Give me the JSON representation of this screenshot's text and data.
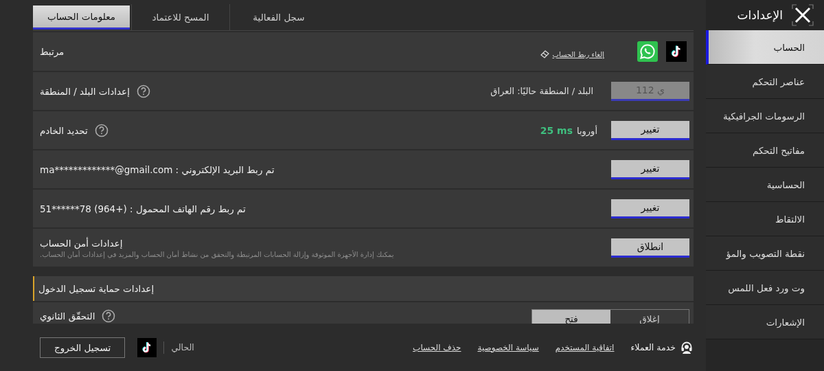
{
  "header": {
    "title": "الإعدادات"
  },
  "sidebar": {
    "items": [
      {
        "label": "الحساب",
        "selected": true
      },
      {
        "label": "عناصر التحكم",
        "selected": false
      },
      {
        "label": "الرسومات الجرافيكية",
        "selected": false
      },
      {
        "label": "مفاتيح التحكم",
        "selected": false
      },
      {
        "label": "الحساسية",
        "selected": false
      },
      {
        "label": "الالتقاط",
        "selected": false
      },
      {
        "label": "نقطة التصويب والمؤ",
        "selected": false
      },
      {
        "label": "وت ورد فعل اللمس",
        "selected": false
      },
      {
        "label": "الإشعارات",
        "selected": false
      }
    ]
  },
  "tabs": [
    {
      "label": "سجل الفعالية",
      "selected": false
    },
    {
      "label": "المسح للاعتماد",
      "selected": false
    },
    {
      "label": "معلومات الحساب",
      "selected": true
    }
  ],
  "rows": [
    {
      "kind": "linked",
      "label": "مرتبط",
      "unlink_link": "إلغاء ربط الحساب"
    },
    {
      "kind": "setting",
      "label": "إعدادات البلد / المنطقة",
      "help": true,
      "value": "البلد / المنطقة حاليًا: العراق",
      "button": {
        "label": "112 ي",
        "disabled": true
      }
    },
    {
      "kind": "server",
      "label": "تحديد الخادم",
      "help": true,
      "region": "أوروبا",
      "ping": "25 ms",
      "button": {
        "label": "تغيير",
        "disabled": false
      }
    },
    {
      "kind": "setting",
      "label": "تم ربط البريد الإلكتروني : ma*************@gmail.com",
      "help": false,
      "button": {
        "label": "تغيير",
        "disabled": false
      }
    },
    {
      "kind": "setting",
      "label": "تم ربط رقم الهاتف المحمول : (+964) 78******51",
      "help": false,
      "button": {
        "label": "تغيير",
        "disabled": false
      }
    },
    {
      "kind": "security",
      "label": "إعدادات أمن الحساب",
      "description": "يمكنك إدارة الأجهزة الموثوقة وإزالة الحسابات المرتبطة والتحقق من نشاط أمان الحساب والمزيد في إعدادات أمان الحساب.",
      "button": {
        "label": "انطلاق",
        "disabled": false
      }
    },
    {
      "kind": "section",
      "label": "إعدادات حماية تسجيل الدخول"
    },
    {
      "kind": "toggle",
      "label": "التحقّق الثانوي",
      "help": true,
      "options": [
        {
          "label": "إغلاق",
          "selected": false
        },
        {
          "label": "فتح",
          "selected": true
        }
      ]
    }
  ],
  "footer": {
    "logout": "تسجيل الخروج",
    "current_label": "الحالي",
    "support": "خدمة العملاء",
    "links": [
      "اتفاقية المستخدم",
      "سياسة الخصوصية",
      "حذف الحساب"
    ]
  }
}
